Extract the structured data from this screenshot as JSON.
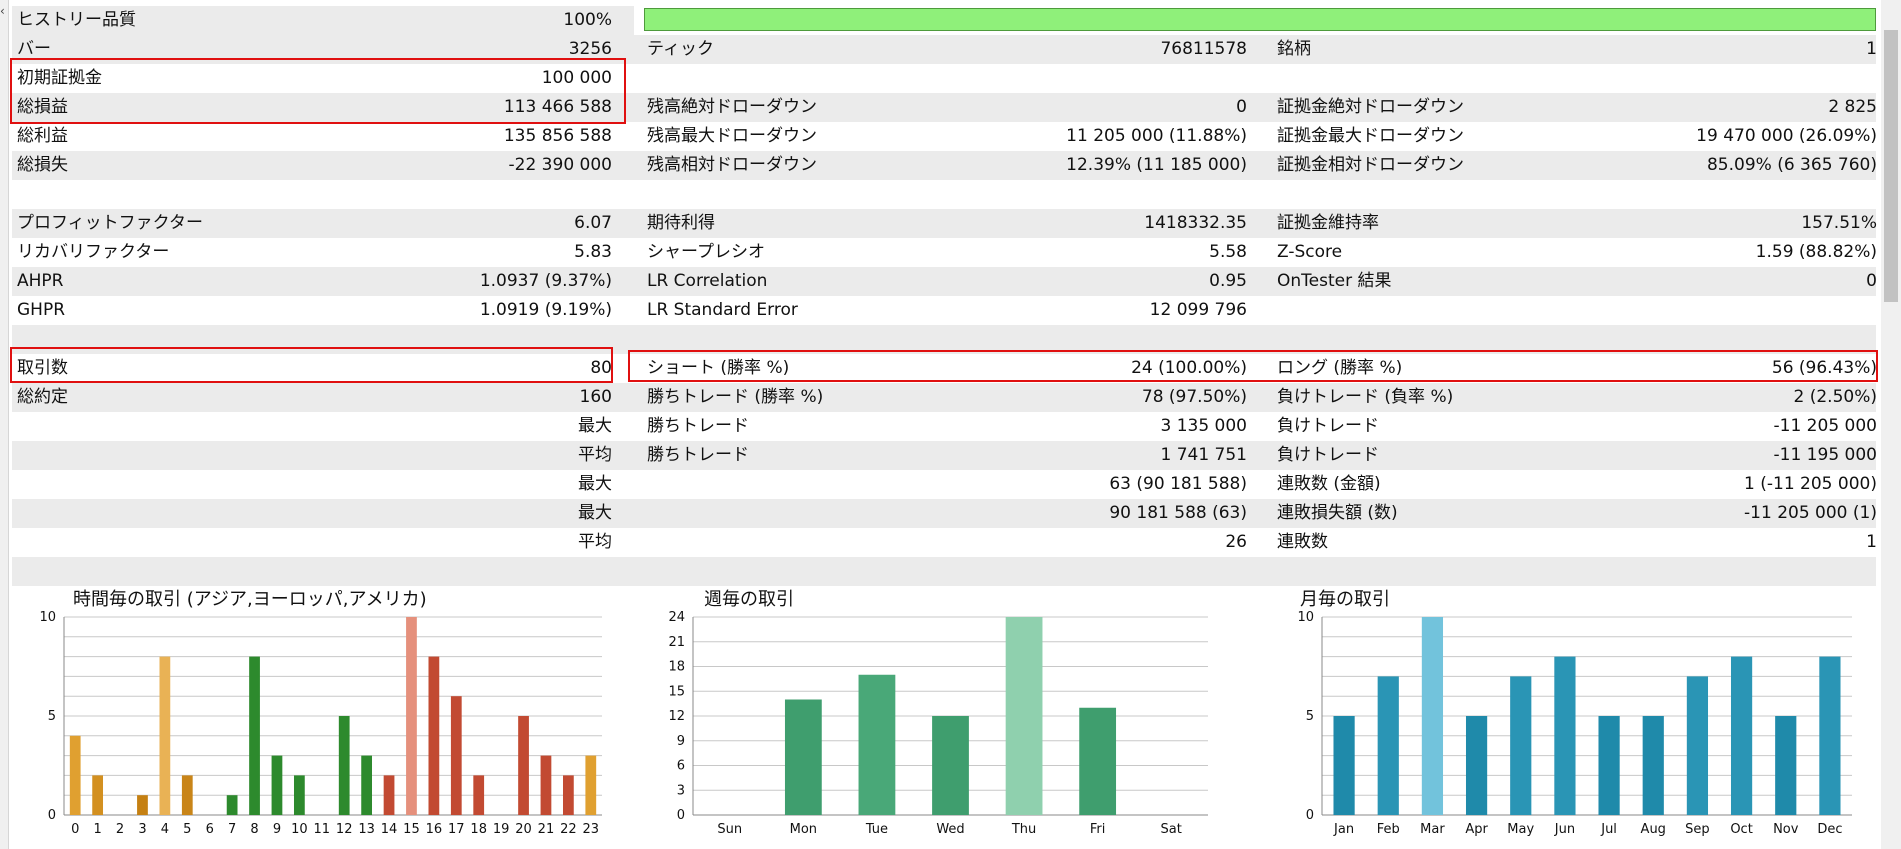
{
  "stats": {
    "rows": [
      {
        "c1": {
          "label": "ヒストリー品質",
          "value": "100%"
        },
        "quality_bar_fraction": 1.0,
        "colors": {
          "bar": "#8ff07a"
        }
      },
      {
        "c1": {
          "label": "バー",
          "value": "3256"
        },
        "c2": {
          "label": "ティック",
          "value": "76811578"
        },
        "c3": {
          "label": "銘柄",
          "value": "1"
        }
      },
      {
        "c1": {
          "label": "初期証拠金",
          "value": "100 000"
        }
      },
      {
        "c1": {
          "label": "総損益",
          "value": "113 466 588"
        },
        "c2": {
          "label": "残高絶対ドローダウン",
          "value": "0"
        },
        "c3": {
          "label": "証拠金絶対ドローダウン",
          "value": "2 825"
        }
      },
      {
        "c1": {
          "label": "総利益",
          "value": "135 856 588"
        },
        "c2": {
          "label": "残高最大ドローダウン",
          "value": "11 205 000 (11.88%)"
        },
        "c3": {
          "label": "証拠金最大ドローダウン",
          "value": "19 470 000 (26.09%)"
        }
      },
      {
        "c1": {
          "label": "総損失",
          "value": "-22 390 000"
        },
        "c2": {
          "label": "残高相対ドローダウン",
          "value": "12.39% (11 185 000)"
        },
        "c3": {
          "label": "証拠金相対ドローダウン",
          "value": "85.09% (6 365 760)"
        }
      },
      {},
      {
        "c1": {
          "label": "プロフィットファクター",
          "value": "6.07"
        },
        "c2": {
          "label": "期待利得",
          "value": "1418332.35"
        },
        "c3": {
          "label": "証拠金維持率",
          "value": "157.51%"
        }
      },
      {
        "c1": {
          "label": "リカバリファクター",
          "value": "5.83"
        },
        "c2": {
          "label": "シャープレシオ",
          "value": "5.58"
        },
        "c3": {
          "label": "Z-Score",
          "value": "1.59 (88.82%)"
        }
      },
      {
        "c1": {
          "label": "AHPR",
          "value": "1.0937 (9.37%)"
        },
        "c2": {
          "label": "LR Correlation",
          "value": "0.95"
        },
        "c3": {
          "label": "OnTester 結果",
          "value": "0"
        }
      },
      {
        "c1": {
          "label": "GHPR",
          "value": "1.0919 (9.19%)"
        },
        "c2": {
          "label": "LR Standard Error",
          "value": "12 099 796"
        }
      },
      {},
      {
        "c1": {
          "label": "取引数",
          "value": "80"
        },
        "c2": {
          "label": "ショート (勝率 %)",
          "value": "24 (100.00%)"
        },
        "c3": {
          "label": "ロング (勝率 %)",
          "value": "56 (96.43%)"
        }
      },
      {
        "c1": {
          "label": "総約定",
          "value": "160"
        },
        "c2": {
          "label": "勝ちトレード (勝率 %)",
          "value": "78 (97.50%)"
        },
        "c3": {
          "label": "負けトレード (負率 %)",
          "value": "2 (2.50%)"
        }
      },
      {
        "c1": {
          "label": "",
          "value": "最大"
        },
        "c2": {
          "label": "勝ちトレード",
          "value": "3 135 000"
        },
        "c3": {
          "label": "負けトレード",
          "value": "-11 205 000"
        }
      },
      {
        "c1": {
          "label": "",
          "value": "平均"
        },
        "c2": {
          "label": "勝ちトレード",
          "value": "1 741 751"
        },
        "c3": {
          "label": "負けトレード",
          "value": "-11 195 000"
        }
      },
      {
        "c1": {
          "label": "",
          "value": "最大"
        },
        "c2": {
          "label": "",
          "value": "63 (90 181 588)"
        },
        "c3": {
          "label": "連敗数 (金額)",
          "value": "1 (-11 205 000)"
        }
      },
      {
        "c1": {
          "label": "",
          "value": "最大"
        },
        "c2": {
          "label": "",
          "value": "90 181 588 (63)"
        },
        "c3": {
          "label": "連敗損失額 (数)",
          "value": "-11 205 000 (1)"
        }
      },
      {
        "c1": {
          "label": "",
          "value": "平均"
        },
        "c2": {
          "label": "",
          "value": "26"
        },
        "c3": {
          "label": "連敗数",
          "value": "1"
        }
      },
      {}
    ]
  },
  "highlight_color": "#e01010",
  "chart_data": [
    {
      "type": "bar",
      "title": "時間毎の取引 (アジア,ヨーロッパ,アメリカ)",
      "categories": [
        "0",
        "1",
        "2",
        "3",
        "4",
        "5",
        "6",
        "7",
        "8",
        "9",
        "10",
        "11",
        "12",
        "13",
        "14",
        "15",
        "16",
        "17",
        "18",
        "19",
        "20",
        "21",
        "22",
        "23"
      ],
      "values": [
        4,
        2,
        0,
        1,
        8,
        2,
        0,
        1,
        8,
        3,
        2,
        0,
        5,
        3,
        2,
        10,
        8,
        6,
        2,
        0,
        5,
        3,
        2,
        3
      ],
      "ylim": [
        0,
        10
      ],
      "yticks": [
        0,
        5,
        10
      ],
      "colors": [
        "#e0a030",
        "#d39020",
        "#c88010",
        "#c58012",
        "#e9b255",
        "#c98518",
        "#c88010",
        "#2d8a2d",
        "#2d8a2d",
        "#2d8a2d",
        "#2d8a2d",
        "#2d8a2d",
        "#2d8a2d",
        "#2d8a2d",
        "#c24a32",
        "#e5907c",
        "#c24a32",
        "#c24a32",
        "#c24a32",
        "#c24a32",
        "#c24a32",
        "#c24a32",
        "#c24a32",
        "#e0a030"
      ]
    },
    {
      "type": "bar",
      "title": "週毎の取引",
      "categories": [
        "Sun",
        "Mon",
        "Tue",
        "Wed",
        "Thu",
        "Fri",
        "Sat"
      ],
      "values": [
        0,
        14,
        17,
        12,
        24,
        13,
        0
      ],
      "ylim": [
        0,
        24
      ],
      "yticks": [
        0,
        3,
        6,
        9,
        12,
        15,
        18,
        21,
        24
      ],
      "colors": [
        "#3f9e6e",
        "#3f9e6e",
        "#49a878",
        "#3f9e6e",
        "#8fd0ae",
        "#3f9e6e",
        "#3f9e6e"
      ]
    },
    {
      "type": "bar",
      "title": "月毎の取引",
      "categories": [
        "Jan",
        "Feb",
        "Mar",
        "Apr",
        "May",
        "Jun",
        "Jul",
        "Aug",
        "Sep",
        "Oct",
        "Nov",
        "Dec"
      ],
      "values": [
        5,
        7,
        10,
        5,
        7,
        8,
        5,
        5,
        7,
        8,
        5,
        8
      ],
      "ylim": [
        0,
        10
      ],
      "yticks": [
        0,
        5,
        10
      ],
      "colors": [
        "#1f8aaa",
        "#2a95b5",
        "#72c3dc",
        "#1f8aaa",
        "#2a95b5",
        "#2a95b5",
        "#1f8aaa",
        "#1f8aaa",
        "#2a95b5",
        "#2a95b5",
        "#1f8aaa",
        "#2a95b5"
      ]
    }
  ]
}
